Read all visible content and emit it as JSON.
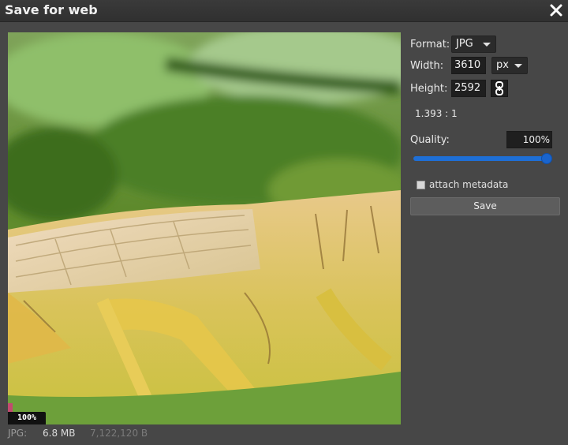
{
  "dialog": {
    "title": "Save for web",
    "close_icon": "close-icon"
  },
  "preview": {
    "zoom": "100%",
    "image_description_icon": "grasshopper-photo"
  },
  "status": {
    "format": "JPG:",
    "size": "6.8 MB",
    "bytes": "7,122,120 B"
  },
  "settings": {
    "format_label": "Format:",
    "format_value": "JPG",
    "width_label": "Width:",
    "width_value": "3610",
    "unit_value": "px",
    "height_label": "Height:",
    "height_value": "2592",
    "link_icon": "chain-link-icon",
    "ratio": "1.393 : 1",
    "quality_label": "Quality:",
    "quality_value": "100%",
    "quality_fraction": 1.0,
    "metadata_label": "attach metadata",
    "metadata_checked": false,
    "save_label": "Save"
  },
  "colors": {
    "accent": "#1e6fd6",
    "background": "#474747",
    "titlebar": "#333333"
  }
}
